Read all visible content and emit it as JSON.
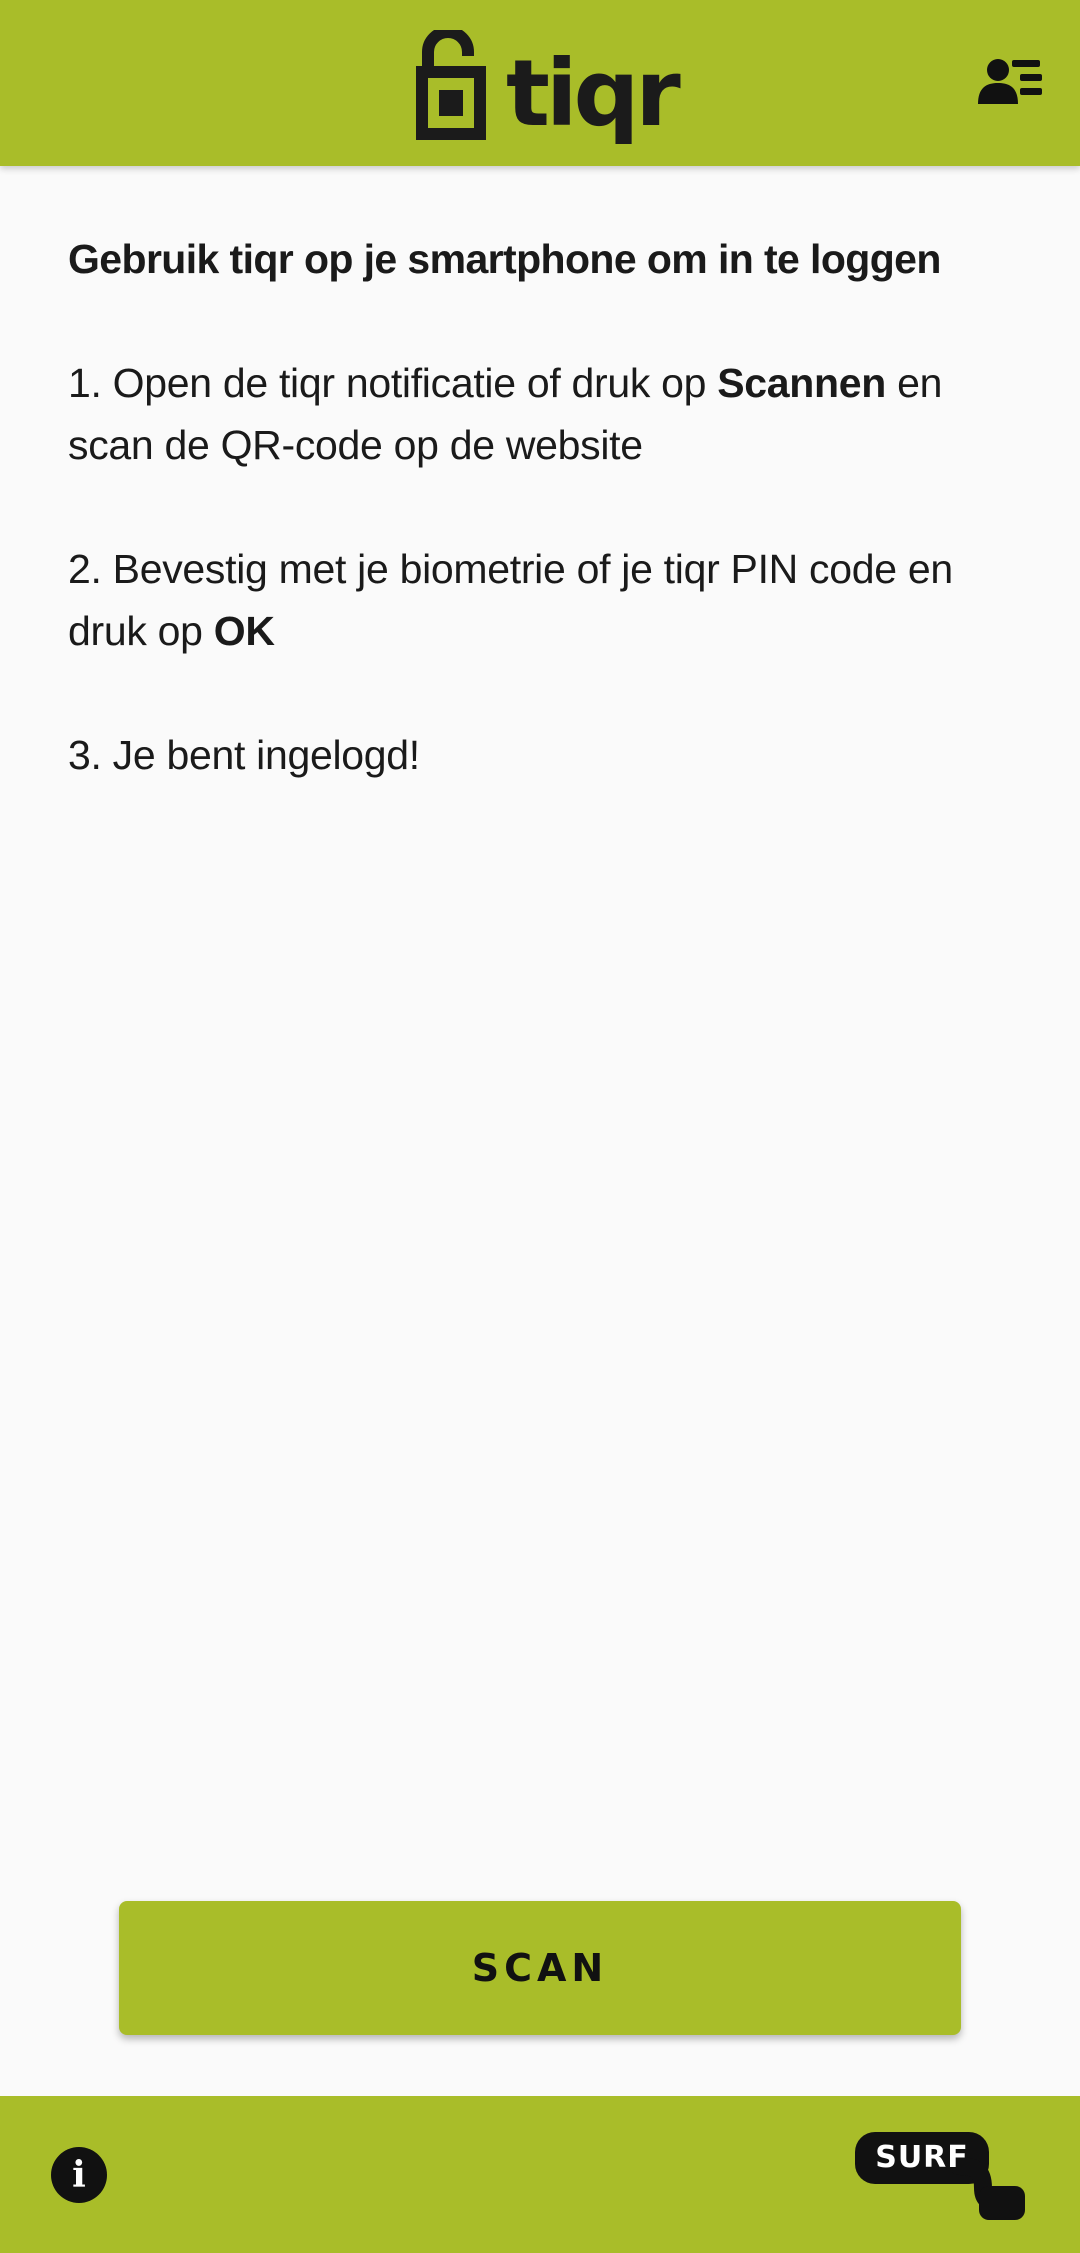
{
  "header": {
    "app_name": "tiqr",
    "identities_icon": "person-list-icon"
  },
  "main": {
    "heading": "Gebruik tiqr op je smartphone om in te loggen",
    "step1": {
      "prefix": "1. Open de tiqr notificatie of druk op ",
      "bold": "Scannen",
      "suffix": " en scan de QR-code op de website"
    },
    "step2": {
      "prefix": "2. Bevestig met je biometrie of je tiqr PIN code en druk op ",
      "bold": "OK"
    },
    "step3": {
      "text": "3. Je bent ingelogd!"
    }
  },
  "scan_button": {
    "label": "SCAN"
  },
  "footer": {
    "info_icon": "info-icon",
    "info_glyph": "i",
    "brand": "SURF"
  },
  "colors": {
    "accent": "#a9bd29",
    "background": "#fafafa",
    "text": "#1a1a1a"
  }
}
